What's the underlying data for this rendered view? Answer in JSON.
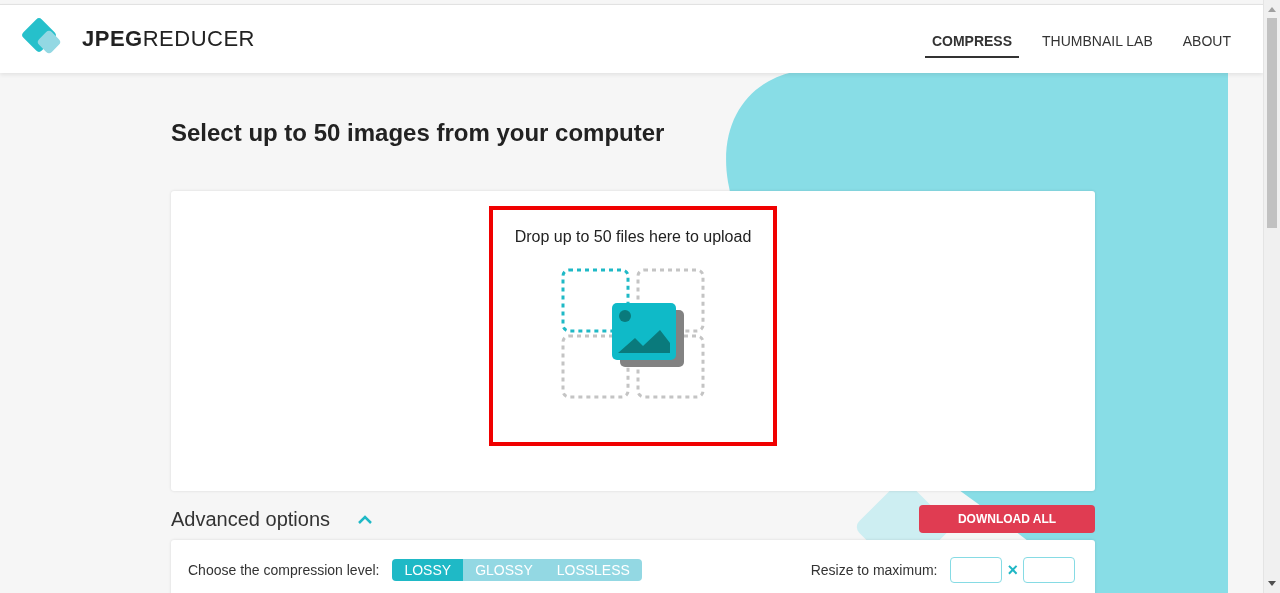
{
  "header": {
    "logo": "**JPEG**REDUCER",
    "nav": [
      {
        "label": "COMPRESS",
        "selected": true
      },
      {
        "label": "THUMBNAIL LAB",
        "selected": false
      },
      {
        "label": "ABOUT",
        "selected": false
      }
    ]
  },
  "title": "Select up to 50 images from your computer",
  "dropzone": {
    "text": "Drop up to 50 files here to upload",
    "highlighted": true
  },
  "advanced": {
    "label": "Advanced options",
    "expanded": true
  },
  "download_button": "DOWNLOAD ALL",
  "options": {
    "compression_label": "Choose the compression level:",
    "levels": [
      {
        "label": "LOSSY",
        "selected": true
      },
      {
        "label": "GLOSSY",
        "selected": false
      },
      {
        "label": "LOSSLESS",
        "selected": false
      }
    ],
    "resize_label": "Resize to maximum:",
    "times": "×"
  }
}
